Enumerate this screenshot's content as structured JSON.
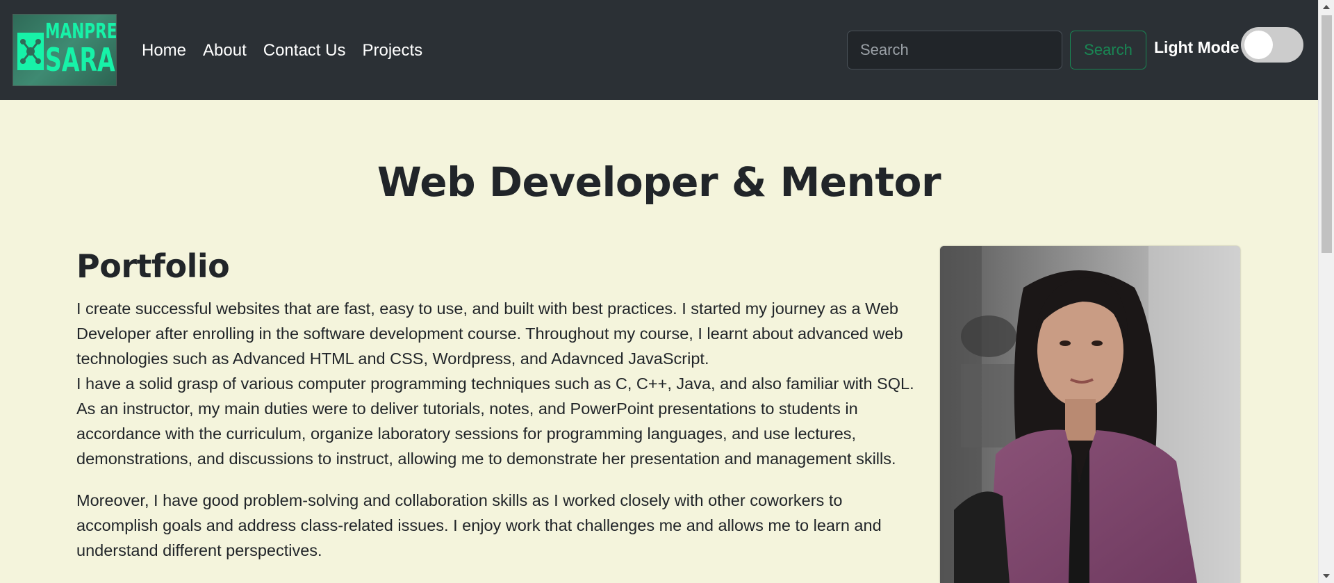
{
  "brand": {
    "logo_line1": "MANPREET",
    "logo_line2": "SARAO",
    "logo_color": "#17f2a8"
  },
  "nav": {
    "links": [
      {
        "label": "Home"
      },
      {
        "label": "About"
      },
      {
        "label": "Contact Us"
      },
      {
        "label": "Projects"
      }
    ]
  },
  "search": {
    "placeholder": "Search",
    "value": "",
    "button_label": "Search",
    "button_color": "#198754"
  },
  "theme_toggle": {
    "label": "Light Mode",
    "state": "off"
  },
  "main": {
    "headline": "Web Developer & Mentor",
    "section_title": "Portfolio",
    "paragraph1": "I create successful websites that are fast, easy to use, and built with best practices. I started my journey as a Web Developer after enrolling in the software development course. Throughout my course, I learnt about advanced web technologies such as Advanced HTML and CSS, Wordpress, and Adavnced JavaScript.",
    "paragraph2": "I have a solid grasp of various computer programming techniques such as C, C++, Java, and also familiar with SQL. As an instructor, my main duties were to deliver tutorials, notes, and PowerPoint presentations to students in accordance with the curriculum, organize laboratory sessions for programming languages, and use lectures, demonstrations, and discussions to instruct, allowing me to demonstrate her presentation and management skills.",
    "paragraph3": "Moreover, I have good problem-solving and collaboration skills as I worked closely with other coworkers to accomplish goals and address class-related issues. I enjoy work that challenges me and allows me to learn and understand different perspectives."
  },
  "colors": {
    "navbar_bg": "#2b3035",
    "page_bg": "#f4f4dc",
    "text": "#212529"
  }
}
